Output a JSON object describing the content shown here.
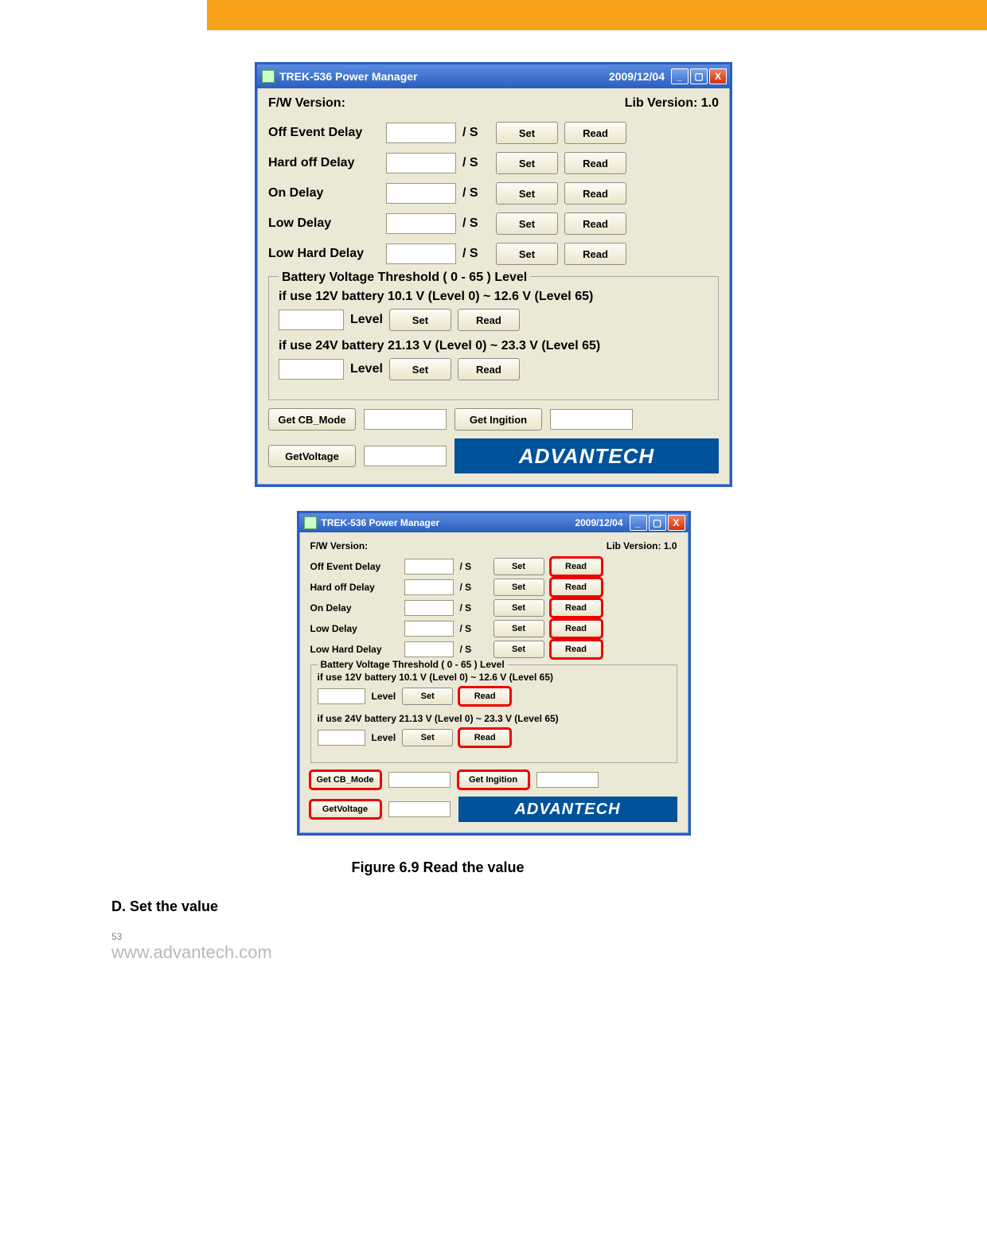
{
  "window": {
    "title": "TREK-536 Power Manager",
    "date": "2009/12/04",
    "fw_label": "F/W Version:",
    "lib_label": "Lib Version: 1.0",
    "unit": "/ S",
    "set": "Set",
    "read": "Read",
    "delays": {
      "off": "Off Event  Delay",
      "hardoff": "Hard off  Delay",
      "on": "On  Delay",
      "low": "Low  Delay",
      "lowhard": "Low Hard  Delay"
    },
    "group": {
      "title": "Battery Voltage Threshold  ( 0 - 65 ) Level",
      "line12": "if use 12V battery      10.1 V (Level 0)  ~  12.6 V (Level 65)",
      "line24": "if use 24V battery      21.13 V (Level 0)  ~  23.3 V (Level 65)",
      "level": "Level"
    },
    "bottom": {
      "cb": "Get CB_Mode",
      "ign": "Get Ingition",
      "volt": "GetVoltage"
    },
    "logo": "ADVANTECH"
  },
  "caption": "Figure 6.9 Read the value",
  "section": "D. Set the value",
  "page_num": "53",
  "site": "www.advantech.com"
}
